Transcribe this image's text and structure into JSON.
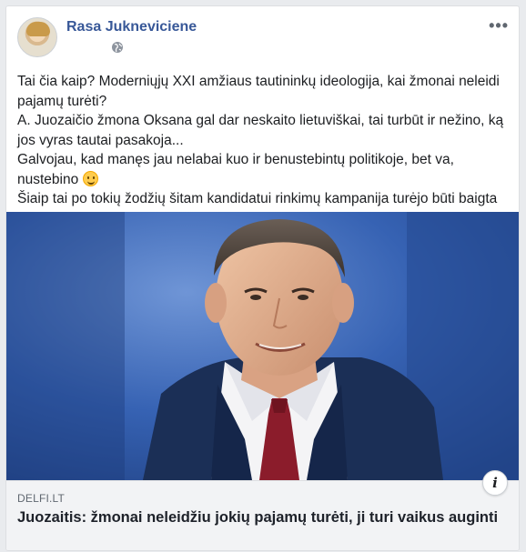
{
  "post": {
    "author": "Rasa Jukneviciene",
    "privacy_icon": "globe-icon",
    "more_icon": "ellipsis-icon",
    "text_lines": [
      "Tai čia kaip? Moderniųjų XXI amžiaus tautininkų ideologija, kai žmonai neleidi pajamų turėti?",
      "A. Juozaičio žmona Oksana gal dar neskaito lietuviškai, tai turbūt ir nežino, ką jos vyras tautai pasakoja...",
      "Galvojau, kad manęs jau nelabai kuo ir benustebintų politikoje, bet va, nustebino",
      "Šiaip tai po tokių žodžių šitam kandidatui rinkimų kampanija turėjo būti baigta"
    ],
    "emoji": "slightly-smiling-face"
  },
  "link": {
    "domain": "DELFI.LT",
    "headline": "Juozaitis: žmonai neleidžiu jokių pajamų turėti, ji turi vaikus auginti",
    "info_icon": "info-icon",
    "info_label": "i"
  },
  "colors": {
    "author": "#385898",
    "photo_background": "#2f5aa8",
    "link_box": "#f2f3f5"
  }
}
